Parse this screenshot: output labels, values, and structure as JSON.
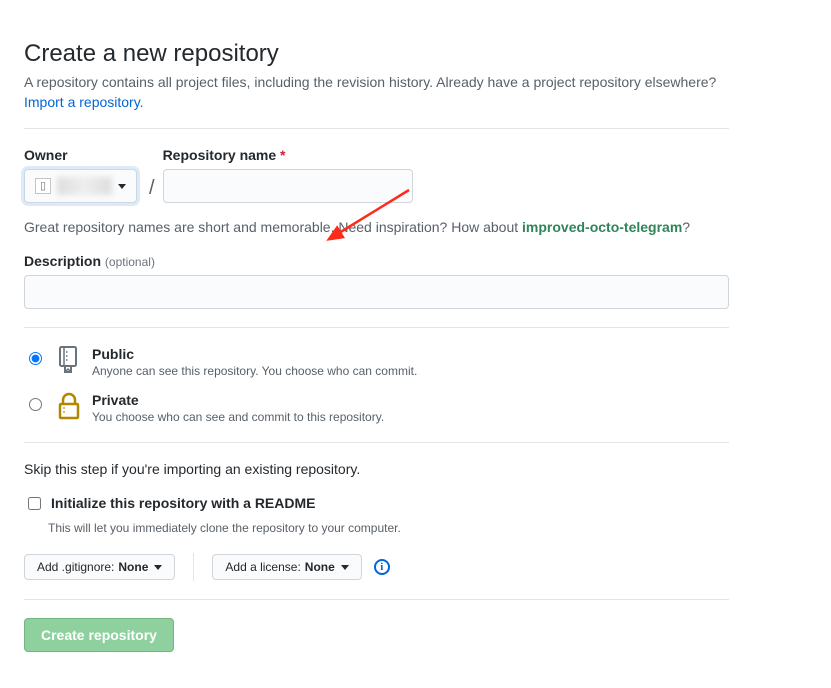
{
  "header": {
    "title": "Create a new repository",
    "tagline": "A repository contains all project files, including the revision history. Already have a project repository elsewhere?",
    "import_link": "Import a repository."
  },
  "owner": {
    "label": "Owner",
    "avatar_alt": "avatar"
  },
  "repo": {
    "label": "Repository name",
    "asterisk": "*",
    "value": "",
    "hint_prefix": "Great repository names are short and memorable. Need inspiration? How about ",
    "suggestion": "improved-octo-telegram",
    "hint_suffix": "?",
    "slash": "/"
  },
  "description": {
    "label": "Description",
    "optional": "(optional)",
    "value": ""
  },
  "visibility": {
    "public": {
      "title": "Public",
      "desc": "Anyone can see this repository. You choose who can commit."
    },
    "private": {
      "title": "Private",
      "desc": "You choose who can see and commit to this repository."
    }
  },
  "init": {
    "skip_note": "Skip this step if you're importing an existing repository.",
    "readme_label": "Initialize this repository with a README",
    "readme_desc": "This will let you immediately clone the repository to your computer."
  },
  "selectors": {
    "gitignore_label": "Add .gitignore:",
    "gitignore_value": "None",
    "license_label": "Add a license:",
    "license_value": "None",
    "info_char": "i"
  },
  "submit": {
    "label": "Create repository"
  }
}
